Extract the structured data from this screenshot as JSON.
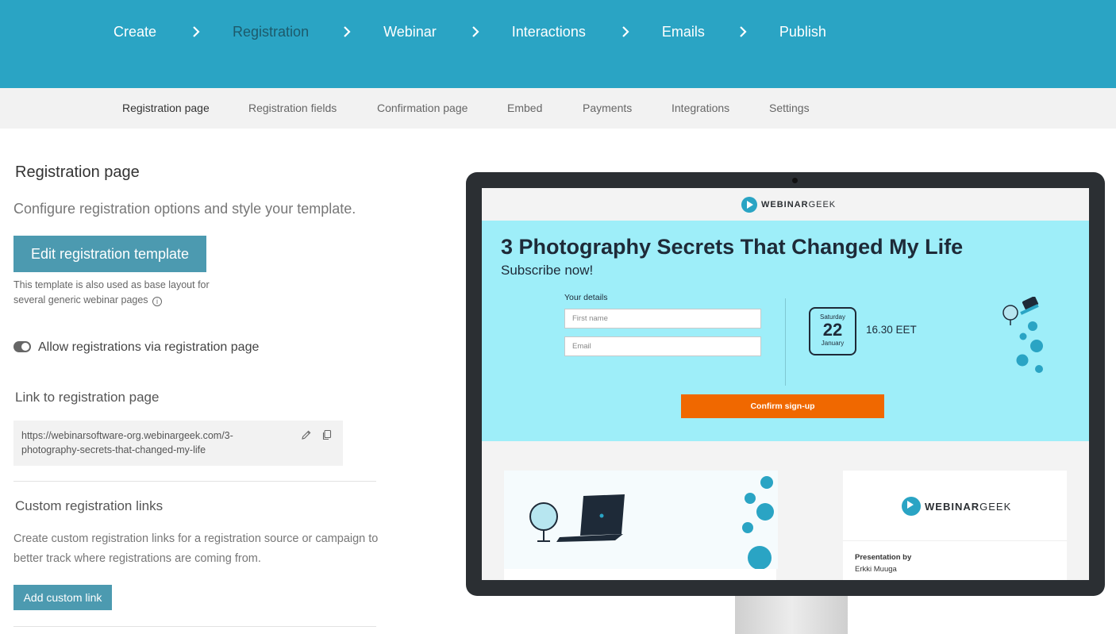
{
  "steps": {
    "create": "Create",
    "registration": "Registration",
    "webinar": "Webinar",
    "interactions": "Interactions",
    "emails": "Emails",
    "publish": "Publish"
  },
  "subnav": {
    "registration_page": "Registration page",
    "registration_fields": "Registration fields",
    "confirmation_page": "Confirmation page",
    "embed": "Embed",
    "payments": "Payments",
    "integrations": "Integrations",
    "settings": "Settings"
  },
  "left": {
    "title": "Registration page",
    "subtitle": "Configure registration options and style your template.",
    "edit_button": "Edit registration template",
    "note": "This template is also used as base layout for several generic webinar pages",
    "toggle_label": "Allow registrations via registration page",
    "toggle_on": true,
    "link_title": "Link to registration page",
    "link_url": "https://webinarsoftware-org.webinargeek.com/3-photography-secrets-that-changed-my-life",
    "custom_title": "Custom registration links",
    "custom_desc": "Create custom registration links for a registration source or campaign to better track where registrations are coming from.",
    "add_button": "Add custom link"
  },
  "preview": {
    "logo_bold": "WEBINAR",
    "logo_light": "GEEK",
    "title": "3 Photography Secrets That Changed My Life",
    "subtitle": "Subscribe now!",
    "details_label": "Your details",
    "first_name_placeholder": "First name",
    "email_placeholder": "Email",
    "day": "Saturday",
    "date": "22",
    "month": "January",
    "time": "16.30 EET",
    "confirm_button": "Confirm sign-up",
    "presentation_by": "Presentation by",
    "presenter": "Erkki Muuga"
  },
  "colors": {
    "topbar": "#2aa4c4",
    "button": "#4c9ab0",
    "hero": "#9eeef9",
    "confirm": "#f06800"
  }
}
